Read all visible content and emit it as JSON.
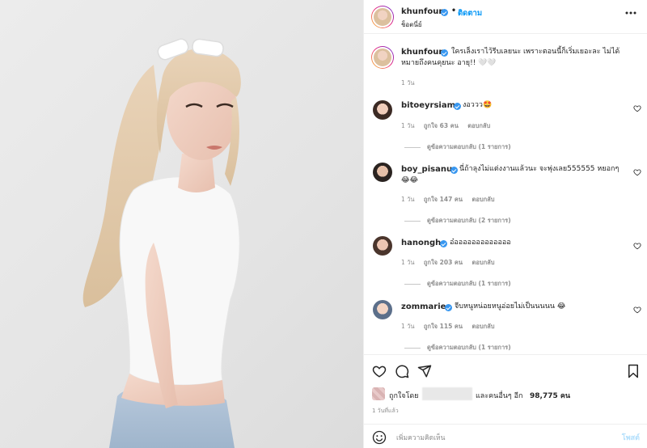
{
  "header": {
    "username": "khunfour",
    "follow_label": "ติดตาม",
    "dot": "•",
    "subtitle": "ช็อตนี่ย์",
    "more_icon": "more-horizontal-icon"
  },
  "caption": {
    "username": "khunfour",
    "text": "ใครเล็งเราไว้รีบเลยนะ เพราะตอนนี้ก็เริ่มเยอะละ ไม่ได้หมายถึงคนคุยนะ อายุ!! 🤍🤍",
    "time": "1 วัน"
  },
  "comments": [
    {
      "username": "bitoeyrsiam",
      "text": "งอววว🤩",
      "time": "1 วัน",
      "likes": "ถูกใจ 63 คน",
      "reply_label": "ตอบกลับ",
      "view_replies": "ดูข้อความตอบกลับ (1 รายการ)"
    },
    {
      "username": "boy_pisanu",
      "text": "นี่ถ้าลุงไม่แต่งงานแล้วนะ จะพุ่งเลย555555 หยอกๆ 😂😂",
      "time": "1 วัน",
      "likes": "ถูกใจ 147 คน",
      "reply_label": "ตอบกลับ",
      "view_replies": "ดูข้อความตอบกลับ (2 รายการ)"
    },
    {
      "username": "hanongh",
      "text": "อ๋อออออออออออออ",
      "time": "1 วัน",
      "likes": "ถูกใจ 203 คน",
      "reply_label": "ตอบกลับ",
      "view_replies": "ดูข้อความตอบกลับ (1 รายการ)"
    },
    {
      "username": "zommarie",
      "text": "จีบหนูหน่อยหนูอ่อยไม่เป็นนนนน 😂",
      "time": "1 วัน",
      "likes": "ถูกใจ 115 คน",
      "reply_label": "ตอบกลับ",
      "view_replies": "ดูข้อความตอบกลับ (1 รายการ)"
    }
  ],
  "actions": {
    "like_icon": "heart-icon",
    "comment_icon": "comment-icon",
    "share_icon": "send-icon",
    "save_icon": "bookmark-icon"
  },
  "likes_summary": {
    "prefix": "ถูกใจโดย",
    "middle": "และคนอื่นๆ อีก",
    "count": "98,775 คน"
  },
  "post_time": "1 วันที่แล้ว",
  "add_comment": {
    "placeholder": "เพิ่มความคิดเห็น",
    "post_label": "โพสต์",
    "emoji_icon": "smiley-icon"
  },
  "colors": {
    "link_blue": "#0095f6",
    "verified_blue": "#3897f0",
    "muted": "#8e8e8e"
  }
}
